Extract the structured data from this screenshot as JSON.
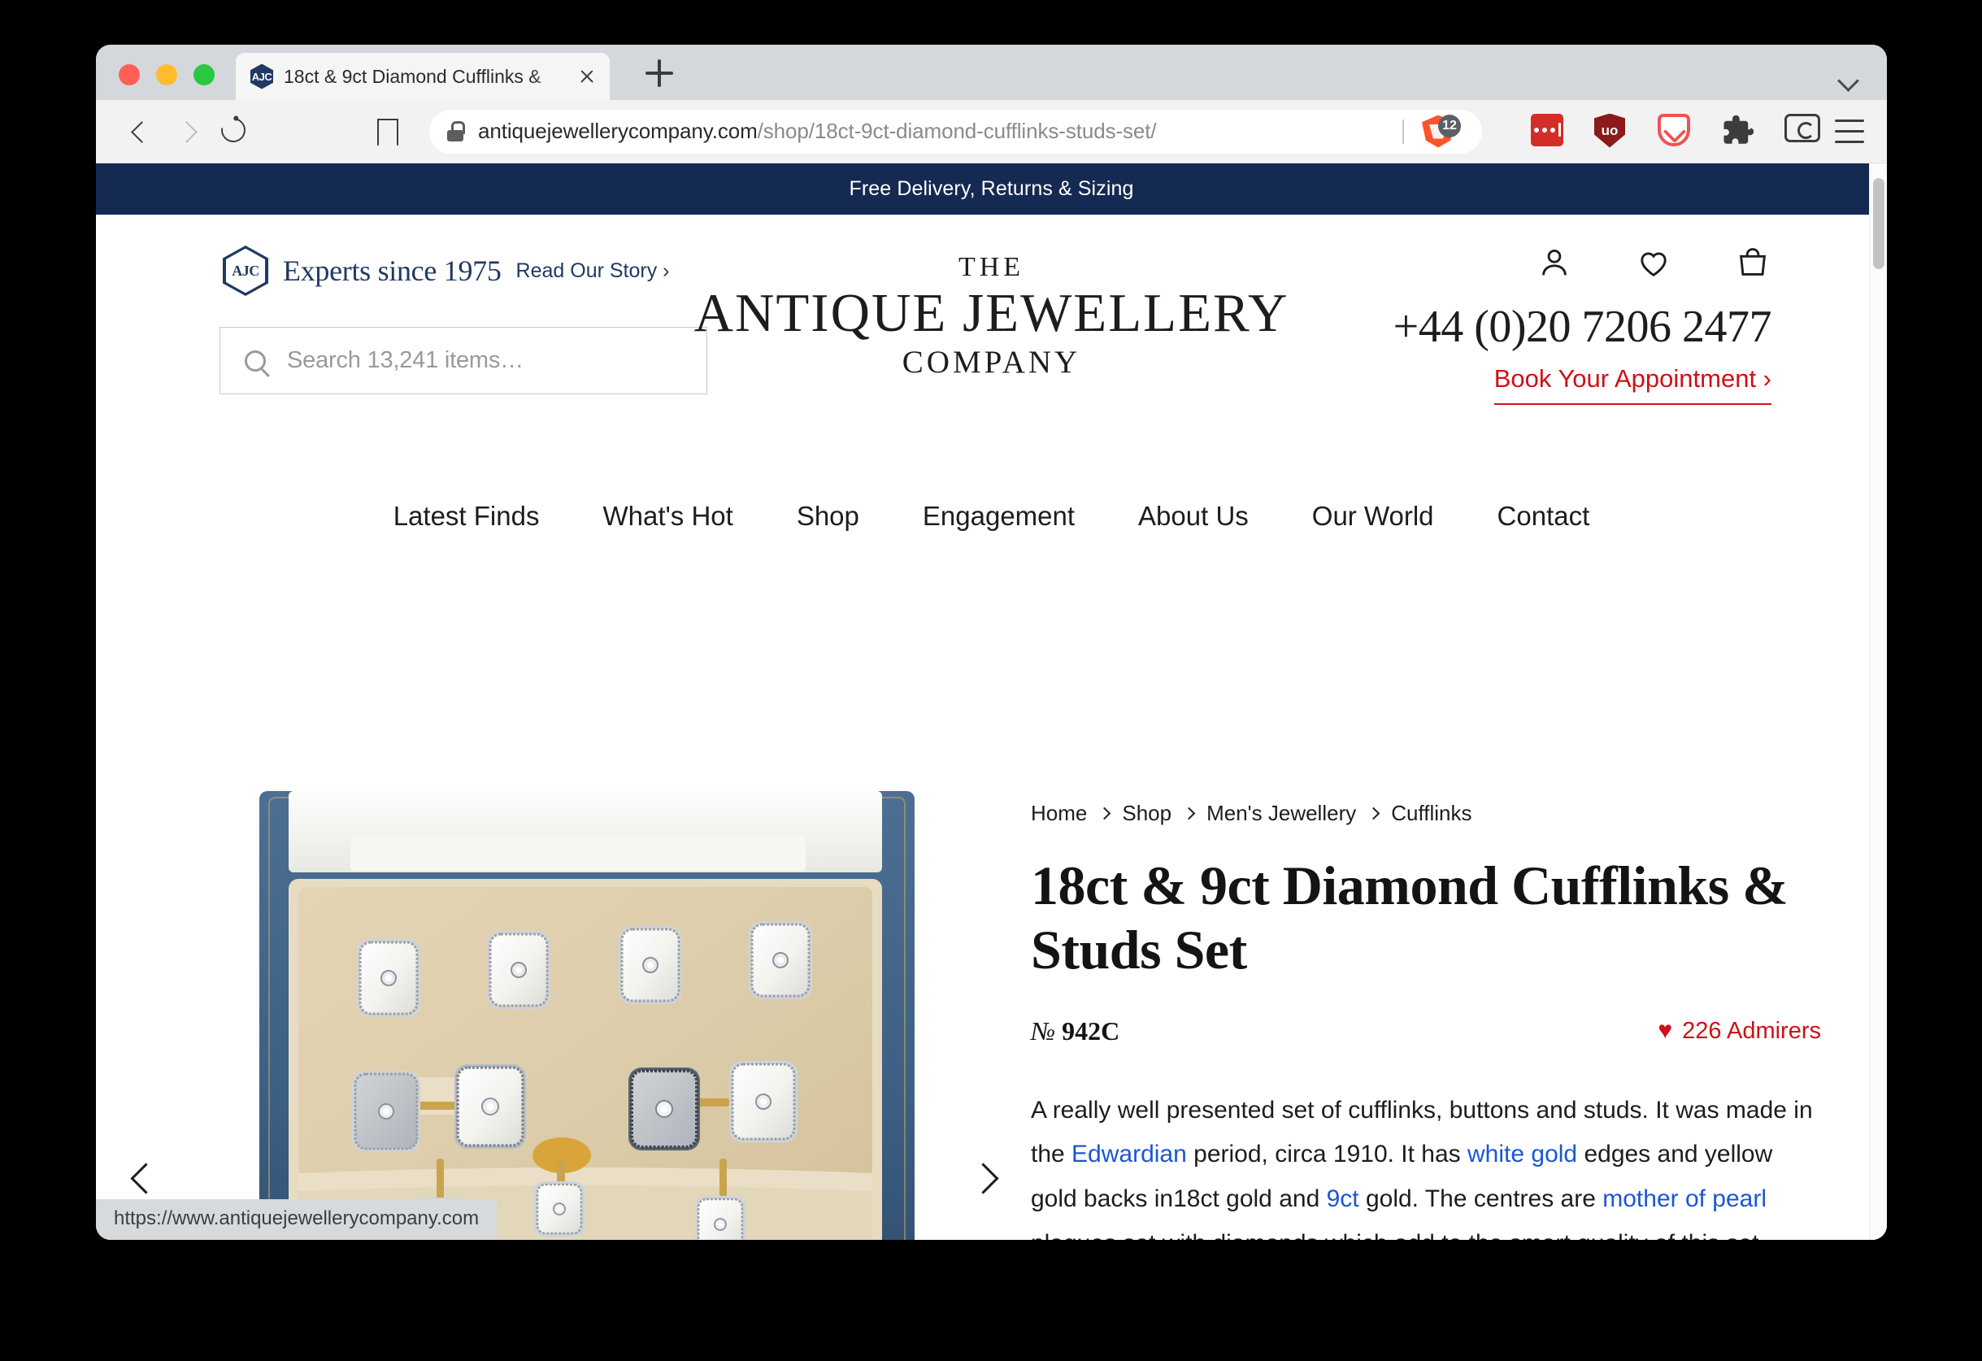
{
  "browser": {
    "window_controls": [
      "close",
      "minimize",
      "zoom"
    ],
    "tab": {
      "title": "18ct & 9ct Diamond Cufflinks &",
      "favicon_label": "AJC",
      "close_label": "×"
    },
    "new_tab_label": "+",
    "toolbar": {
      "back": "Back",
      "forward": "Forward",
      "reload": "Reload",
      "bookmark": "Bookmark this page"
    },
    "address": {
      "domain": "antiquejewellerycompany.com",
      "path": "/shop/18ct-9ct-diamond-cufflinks-studs-set/",
      "secure": true
    },
    "shield": {
      "name": "Brave Shields",
      "count": "12"
    },
    "extensions": [
      {
        "name": "1password-extension",
        "label": "•••"
      },
      {
        "name": "ublock-origin-extension",
        "label": "uo"
      },
      {
        "name": "pocket-extension",
        "label": ""
      },
      {
        "name": "extensions-puzzle",
        "label": ""
      },
      {
        "name": "wallet-extension",
        "label": ""
      }
    ],
    "menu_label": "Customize and control",
    "status_link": "https://www.antiquejewellerycompany.com"
  },
  "site": {
    "announcement": "Free Delivery, Returns & Sizing",
    "experts": {
      "logo_text": "AJC",
      "tagline": "Experts since 1975",
      "read_story": "Read Our Story ›"
    },
    "search": {
      "placeholder": "Search 13,241 items…"
    },
    "wordmark": {
      "line1": "THE",
      "line2": "ANTIQUE JEWELLERY",
      "line3": "COMPANY"
    },
    "header_icons": [
      {
        "name": "account-icon",
        "label": "Account"
      },
      {
        "name": "wishlist-heart-icon",
        "label": "Wishlist"
      },
      {
        "name": "shopping-bag-icon",
        "label": "Bag"
      }
    ],
    "phone": "+44 (0)20 7206 2477",
    "book_appointment": "Book Your Appointment ›",
    "nav": [
      "Latest Finds",
      "What's Hot",
      "Shop",
      "Engagement",
      "About Us",
      "Our World",
      "Contact"
    ]
  },
  "product": {
    "breadcrumb": [
      "Home",
      "Shop",
      "Men's Jewellery",
      "Cufflinks"
    ],
    "title": "18ct & 9ct Diamond Cufflinks & Studs Set",
    "sku_prefix": "№",
    "sku": "942C",
    "admirers": "226 Admirers",
    "description": {
      "p1": "A really well presented set of cufflinks, buttons and studs. It was made in the ",
      "link1": "Edwardian",
      "p2": " period, circa 1910. It has ",
      "link2": "white gold",
      "p3": " edges and yellow gold backs in18ct gold and ",
      "link3": "9ct",
      "p4": " gold. The centres are ",
      "link4": "mother of pearl",
      "p5": " plaques set with diamonds which add to the smart quality of this set."
    },
    "gallery": {
      "prev_label": "Previous image",
      "next_label": "Next image",
      "image_alt": "Antique diamond and mother of pearl cufflinks and studs set in original blue leather box"
    }
  },
  "colors": {
    "announcement_bg": "#152a52",
    "brand_navy": "#1f3a63",
    "accent_red": "#cf1017",
    "link_blue": "#1a56d6"
  }
}
